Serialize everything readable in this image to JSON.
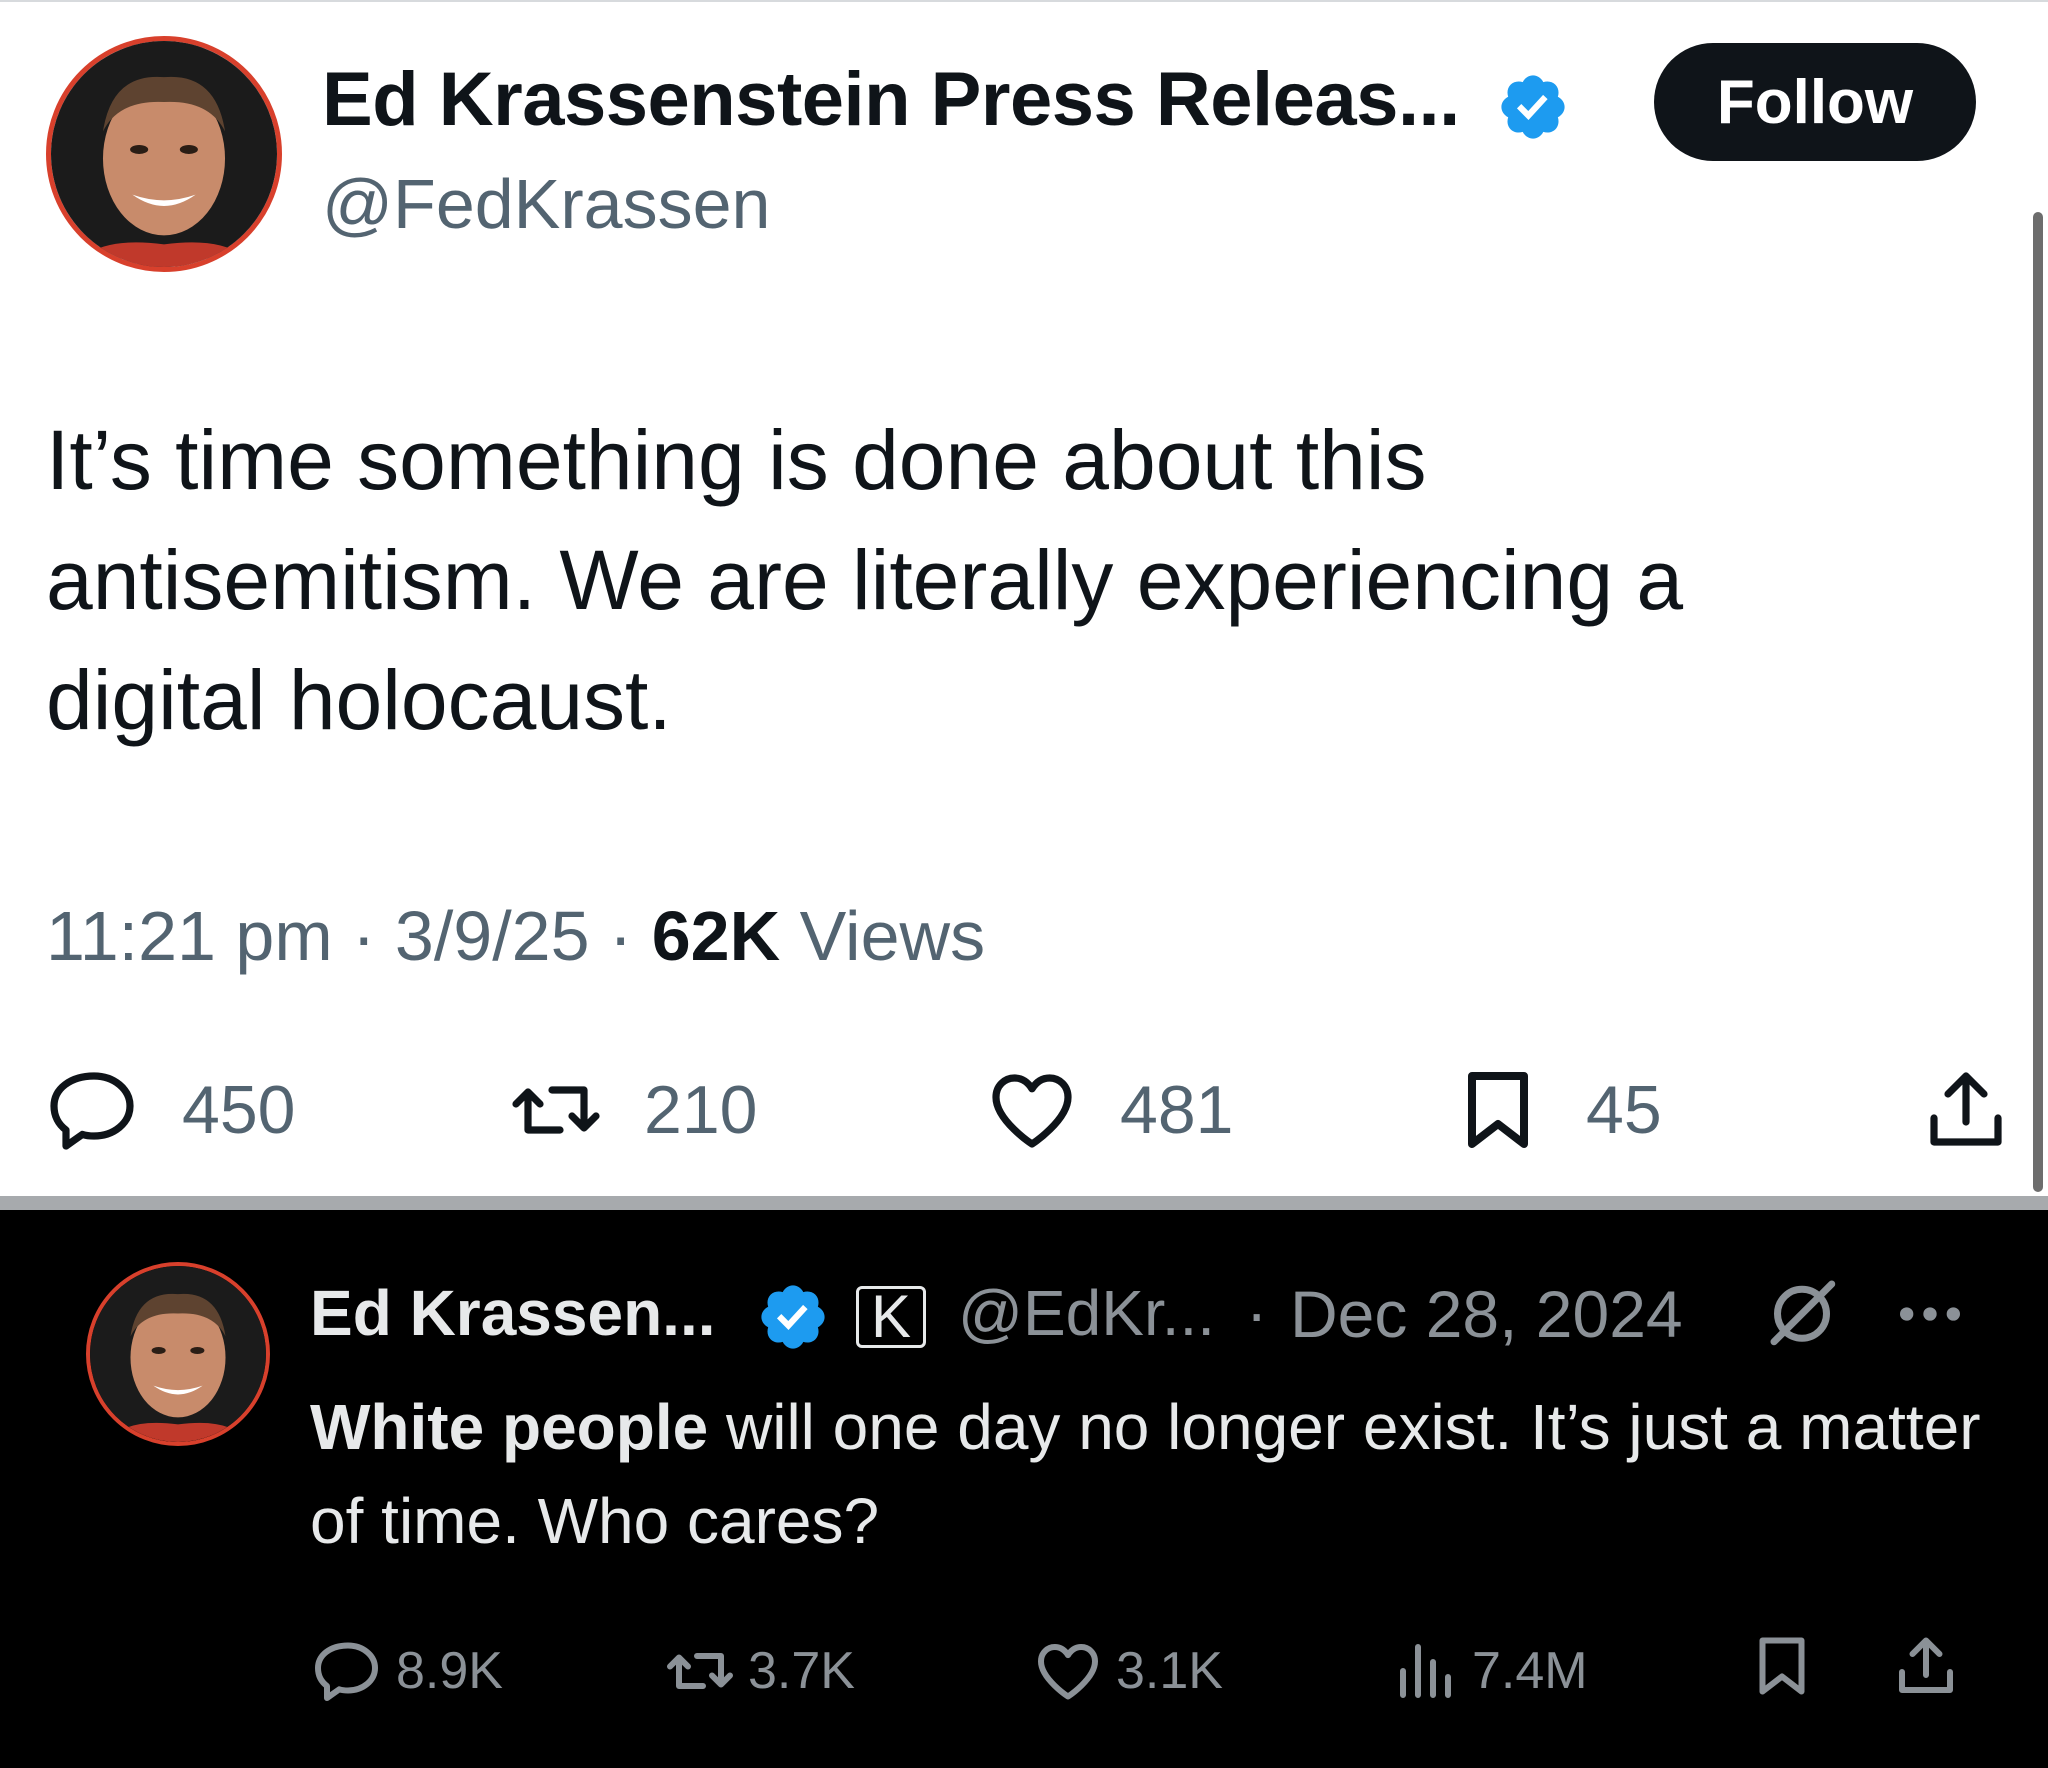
{
  "original_tweet": {
    "display_name": "Ed Krassenstein Press Releas...",
    "handle": "@FedKrassen",
    "follow_label": "Follow",
    "text": "It’s time something is done about this\nantisemitism. We are literally experiencing a\ndigital holocaust.",
    "time": "11:21 pm",
    "date": "3/9/25",
    "views_count": "62K",
    "views_label": "Views",
    "replies": "450",
    "reposts": "210",
    "likes": "481",
    "bookmarks": "45"
  },
  "quoted_tweet": {
    "display_name": "Ed Krassen...",
    "affiliate_badge": "K",
    "handle": "@EdKr...",
    "separator": "·",
    "date": "Dec 28, 2024",
    "text_bold": "White people",
    "text_rest": " will one day no longer exist. It’s just a matter of time. Who cares?",
    "replies": "8.9K",
    "reposts": "3.7K",
    "likes": "3.1K",
    "views": "7.4M"
  },
  "colors": {
    "verified_blue": "#1d9bf0",
    "avatar_ring": "#d8402c",
    "light_text": "#0f1419",
    "light_secondary": "#536471",
    "dark_background": "#000000",
    "dark_text": "#e7e9ea",
    "dark_secondary": "#8b9197"
  },
  "icons": [
    "verified-badge-icon",
    "reply-icon",
    "repost-icon",
    "like-icon",
    "bookmark-icon",
    "share-icon",
    "views-icon",
    "grok-icon",
    "more-icon"
  ]
}
